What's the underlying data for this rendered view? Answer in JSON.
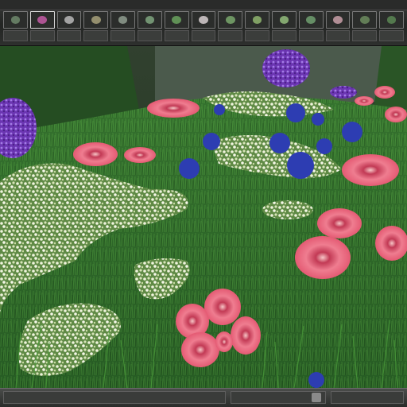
{
  "toolbar": {
    "thumbnails": [
      {
        "icon": "scene-thumb-icon",
        "color": "#6f8a6c"
      },
      {
        "icon": "flower-thumb-icon",
        "color": "#c45ca6"
      },
      {
        "icon": "material-thumb-icon",
        "color": "#b9b9b9"
      },
      {
        "icon": "sphere-thumb-icon",
        "color": "#a7a17a"
      },
      {
        "icon": "camera-thumb-icon",
        "color": "#8f9e8f"
      },
      {
        "icon": "eye-thumb-icon",
        "color": "#7fa67f"
      },
      {
        "icon": "grass-thumb-icon",
        "color": "#6aa35e"
      },
      {
        "icon": "render-thumb-icon",
        "color": "#d7cfd0"
      },
      {
        "icon": "plant-thumb-icon",
        "color": "#79a86c"
      },
      {
        "icon": "leaf-thumb-icon",
        "color": "#8fb56f"
      },
      {
        "icon": "tree-thumb-icon",
        "color": "#93bd7b"
      },
      {
        "icon": "bush-thumb-icon",
        "color": "#70a070"
      },
      {
        "icon": "pink-flower-thumb-icon",
        "color": "#c9a0a8"
      },
      {
        "icon": "meadow-thumb-icon",
        "color": "#6c8c5e"
      },
      {
        "icon": "hedge-thumb-icon",
        "color": "#5b8753"
      }
    ],
    "selected_index": 1
  },
  "viewport": {
    "background_color": "#2c4a2a",
    "grass_color": "#2f6a2a",
    "flower_colors": {
      "pink": "#e8607a",
      "purple": "#7a3fbf",
      "blue": "#2e3fb0",
      "white": "#e4ecd0"
    }
  },
  "statusbar": {
    "icon": "render-status-icon"
  }
}
